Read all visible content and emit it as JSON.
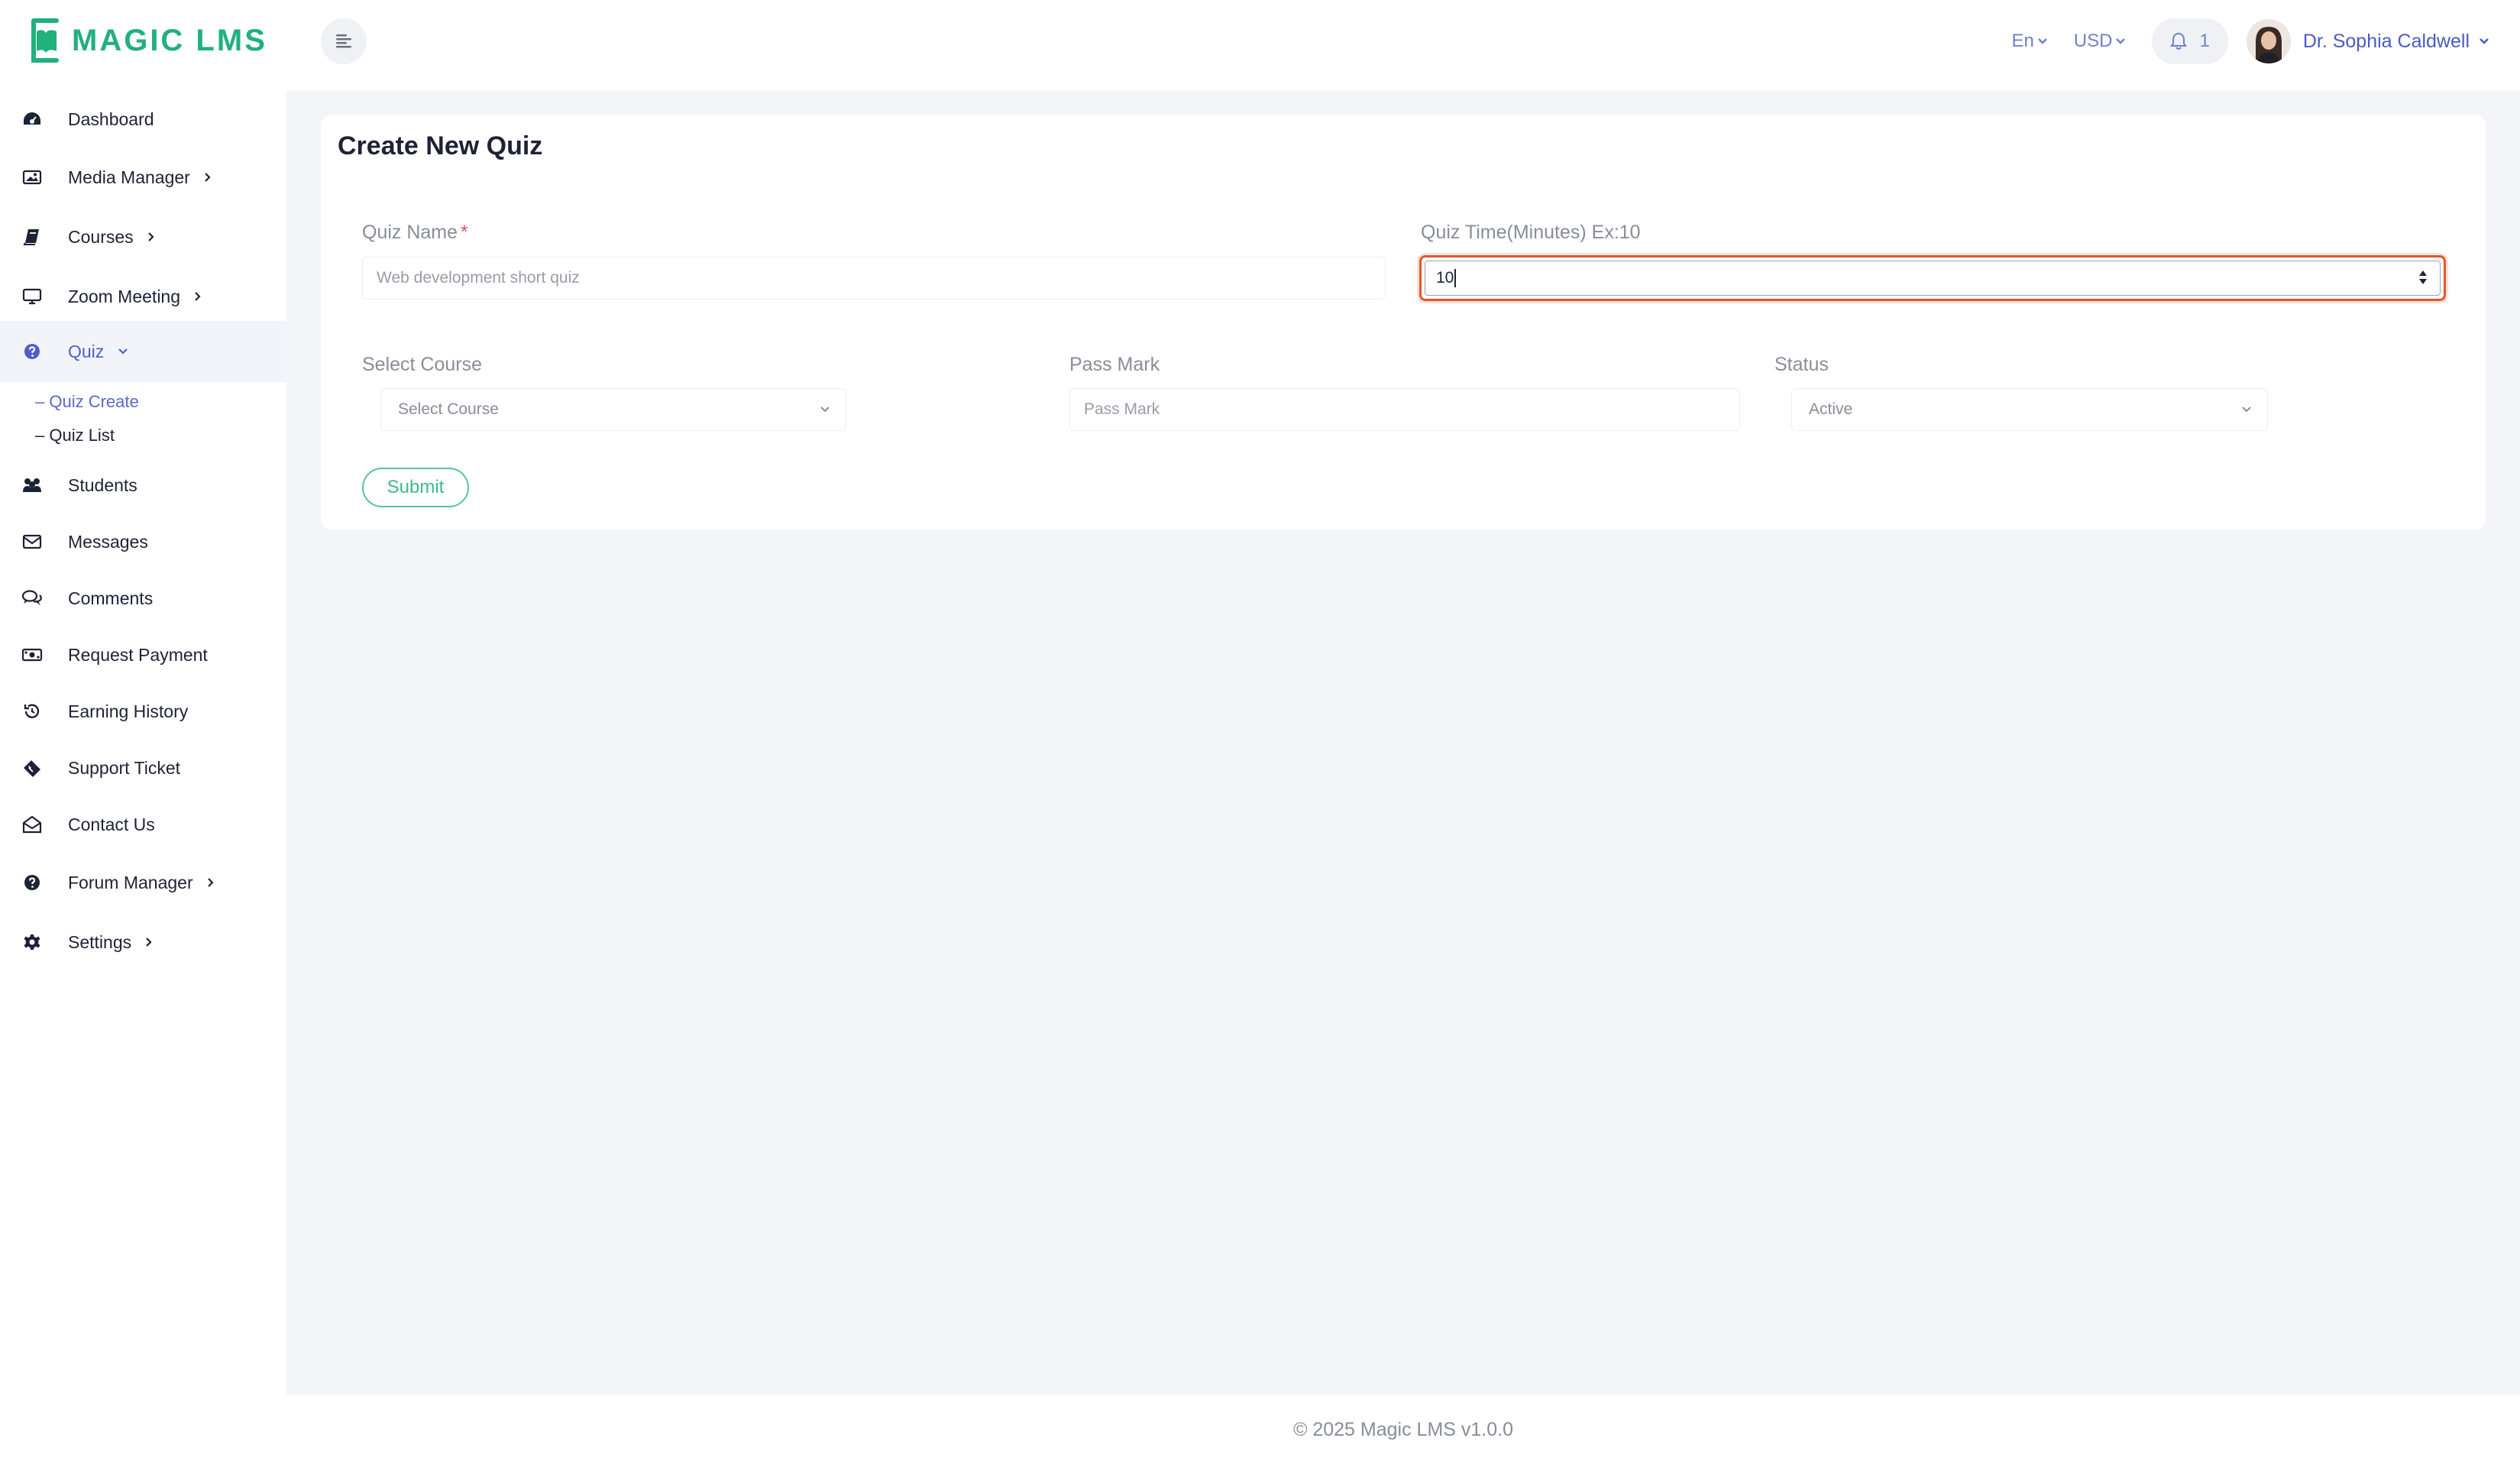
{
  "brand": {
    "name": "MAGIC LMS",
    "accent_color": "#22b07d"
  },
  "header": {
    "menu_toggle_icon": "menu-lines-icon",
    "language": "En",
    "currency": "USD",
    "notification_count": "1",
    "user_name": "Dr. Sophia Caldwell"
  },
  "sidebar": {
    "items": [
      {
        "label": "Dashboard",
        "icon": "dashboard-icon"
      },
      {
        "label": "Media Manager",
        "icon": "image-icon"
      },
      {
        "label": "Courses",
        "icon": "book-icon"
      },
      {
        "label": "Zoom Meeting",
        "icon": "monitor-icon"
      },
      {
        "label": "Quiz",
        "icon": "question-circle-icon"
      },
      {
        "label": "Students",
        "icon": "users-icon"
      },
      {
        "label": "Messages",
        "icon": "envelope-icon"
      },
      {
        "label": "Comments",
        "icon": "comments-icon"
      },
      {
        "label": "Request Payment",
        "icon": "money-icon"
      },
      {
        "label": "Earning History",
        "icon": "history-icon"
      },
      {
        "label": "Support Ticket",
        "icon": "ticket-icon"
      },
      {
        "label": "Contact Us",
        "icon": "envelope-open-icon"
      },
      {
        "label": "Forum Manager",
        "icon": "question-circle-icon"
      },
      {
        "label": "Settings",
        "icon": "gear-icon"
      }
    ],
    "quiz_sub": {
      "create": "– Quiz Create",
      "list": "– Quiz List"
    }
  },
  "form": {
    "title": "Create New Quiz",
    "quiz_name": {
      "label": "Quiz Name",
      "required_mark": "*",
      "placeholder": "Web development short quiz",
      "value": ""
    },
    "quiz_time": {
      "label": "Quiz Time(Minutes) Ex:10",
      "value": "10"
    },
    "course": {
      "label": "Select Course",
      "selected": "Select Course"
    },
    "pass_mark": {
      "label": "Pass Mark",
      "placeholder": "Pass Mark"
    },
    "status": {
      "label": "Status",
      "selected": "Active"
    },
    "submit_label": "Submit"
  },
  "footer": {
    "text": "© 2025 Magic LMS v1.0.0"
  }
}
